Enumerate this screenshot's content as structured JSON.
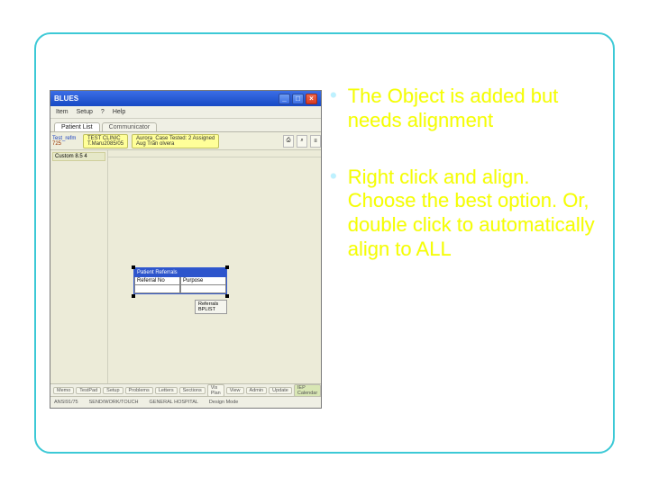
{
  "bullets": [
    "The Object is added but needs alignment",
    "Right click and align. Choose the best option. Or, double click to automatically align to ALL"
  ],
  "app": {
    "title": "BLUES",
    "win_min": "_",
    "win_max": "□",
    "win_close": "×",
    "menu": [
      "Item",
      "Setup",
      "?",
      "Help"
    ],
    "tabs": {
      "items": [
        "Patient List",
        "Communicator"
      ],
      "active": 0
    },
    "toolbar": {
      "left_line1": "Test_refm",
      "left_line2": "725",
      "btn1_line1": "TEST CLINIC",
      "btn1_line2": "T.Maru2085/05",
      "btn2_line1": "Aurora_Case Tested: 2 Assigned",
      "btn2_line2": "Aug Tran olvera",
      "r1": "⎙",
      "r2": "⌕",
      "r3": "≡"
    },
    "sidebar": {
      "header": "Custom 8.5 4"
    },
    "object": {
      "caption": "Patient Referrals",
      "col1": "Referral No",
      "col2": "Purpose",
      "tag": "Referrals BPLIST"
    },
    "bottom_tabs": [
      "Memo",
      "TestPad",
      "Setup",
      "Problems",
      "Letters",
      "Sections",
      "Vis Plan",
      "View",
      "Admin",
      "Update",
      "IEP Calendar"
    ],
    "status": {
      "s1": "ANSI91/75",
      "s2": "SEND/WORK/TOUCH",
      "s3": "GENERAL HOSPITAL",
      "s4": "Design Mode"
    }
  }
}
